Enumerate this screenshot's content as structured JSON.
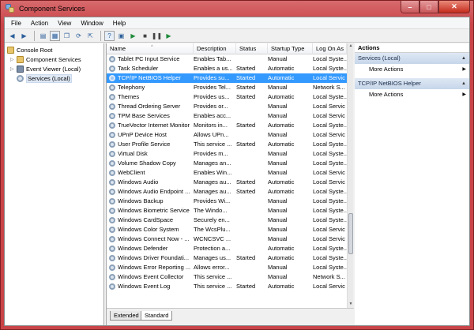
{
  "window": {
    "title": "Component Services"
  },
  "menu": [
    {
      "label": "File"
    },
    {
      "label": "Action"
    },
    {
      "label": "View"
    },
    {
      "label": "Window"
    },
    {
      "label": "Help"
    }
  ],
  "tree": {
    "items": [
      {
        "label": "Console Root",
        "icon": "folder-icon"
      },
      {
        "label": "Component Services",
        "icon": "folder-icon"
      },
      {
        "label": "Event Viewer (Local)",
        "icon": "event-viewer-icon"
      },
      {
        "label": "Services (Local)",
        "icon": "gear-icon"
      }
    ]
  },
  "list": {
    "columns": [
      "Name",
      "Description",
      "Status",
      "Startup Type",
      "Log On As"
    ],
    "selected_row": 2,
    "rows": [
      [
        "Tablet PC Input Service",
        "Enables Tab...",
        "",
        "Manual",
        "Local Syste..."
      ],
      [
        "Task Scheduler",
        "Enables a us...",
        "Started",
        "Automatic",
        "Local Syste..."
      ],
      [
        "TCP/IP NetBIOS Helper",
        "Provides su...",
        "Started",
        "Automatic",
        "Local Servic"
      ],
      [
        "Telephony",
        "Provides Tel...",
        "Started",
        "Manual",
        "Network S..."
      ],
      [
        "Themes",
        "Provides us...",
        "Started",
        "Automatic",
        "Local Syste..."
      ],
      [
        "Thread Ordering Server",
        "Provides or...",
        "",
        "Manual",
        "Local Servic"
      ],
      [
        "TPM Base Services",
        "Enables acc...",
        "",
        "Manual",
        "Local Servic"
      ],
      [
        "TrueVector Internet Monitor",
        "Monitors in...",
        "Started",
        "Automatic",
        "Local Syste..."
      ],
      [
        "UPnP Device Host",
        "Allows UPn...",
        "",
        "Manual",
        "Local Servic"
      ],
      [
        "User Profile Service",
        "This service ...",
        "Started",
        "Automatic",
        "Local Syste..."
      ],
      [
        "Virtual Disk",
        "Provides m...",
        "",
        "Manual",
        "Local Syste..."
      ],
      [
        "Volume Shadow Copy",
        "Manages an...",
        "",
        "Manual",
        "Local Syste..."
      ],
      [
        "WebClient",
        "Enables Win...",
        "",
        "Manual",
        "Local Servic"
      ],
      [
        "Windows Audio",
        "Manages au...",
        "Started",
        "Automatic",
        "Local Servic"
      ],
      [
        "Windows Audio Endpoint ...",
        "Manages au...",
        "Started",
        "Automatic",
        "Local Syste..."
      ],
      [
        "Windows Backup",
        "Provides Wi...",
        "",
        "Manual",
        "Local Syste..."
      ],
      [
        "Windows Biometric Service",
        "The Windo...",
        "",
        "Manual",
        "Local Syste..."
      ],
      [
        "Windows CardSpace",
        "Securely en...",
        "",
        "Manual",
        "Local Syste..."
      ],
      [
        "Windows Color System",
        "The WcsPlu...",
        "",
        "Manual",
        "Local Servic"
      ],
      [
        "Windows Connect Now - ...",
        "WCNCSVC ...",
        "",
        "Manual",
        "Local Servic"
      ],
      [
        "Windows Defender",
        "Protection a...",
        "",
        "Automatic",
        "Local Syste..."
      ],
      [
        "Windows Driver Foundati...",
        "Manages us...",
        "Started",
        "Automatic",
        "Local Syste..."
      ],
      [
        "Windows Error Reporting ...",
        "Allows error...",
        "",
        "Manual",
        "Local Syste..."
      ],
      [
        "Windows Event Collector",
        "This service ...",
        "",
        "Manual",
        "Network S..."
      ],
      [
        "Windows Event Log",
        "This service ...",
        "Started",
        "Automatic",
        "Local Servic"
      ]
    ]
  },
  "tabs": [
    {
      "label": "Extended"
    },
    {
      "label": "Standard"
    }
  ],
  "actions": {
    "title": "Actions",
    "sections": [
      {
        "label": "Services (Local)",
        "items": [
          "More Actions"
        ]
      },
      {
        "label": "TCP/IP NetBIOS Helper",
        "items": [
          "More Actions"
        ]
      }
    ]
  },
  "colors": {
    "selection": "#3399ff",
    "frame": "#c9474b",
    "action_header": "#c6d6ea"
  }
}
